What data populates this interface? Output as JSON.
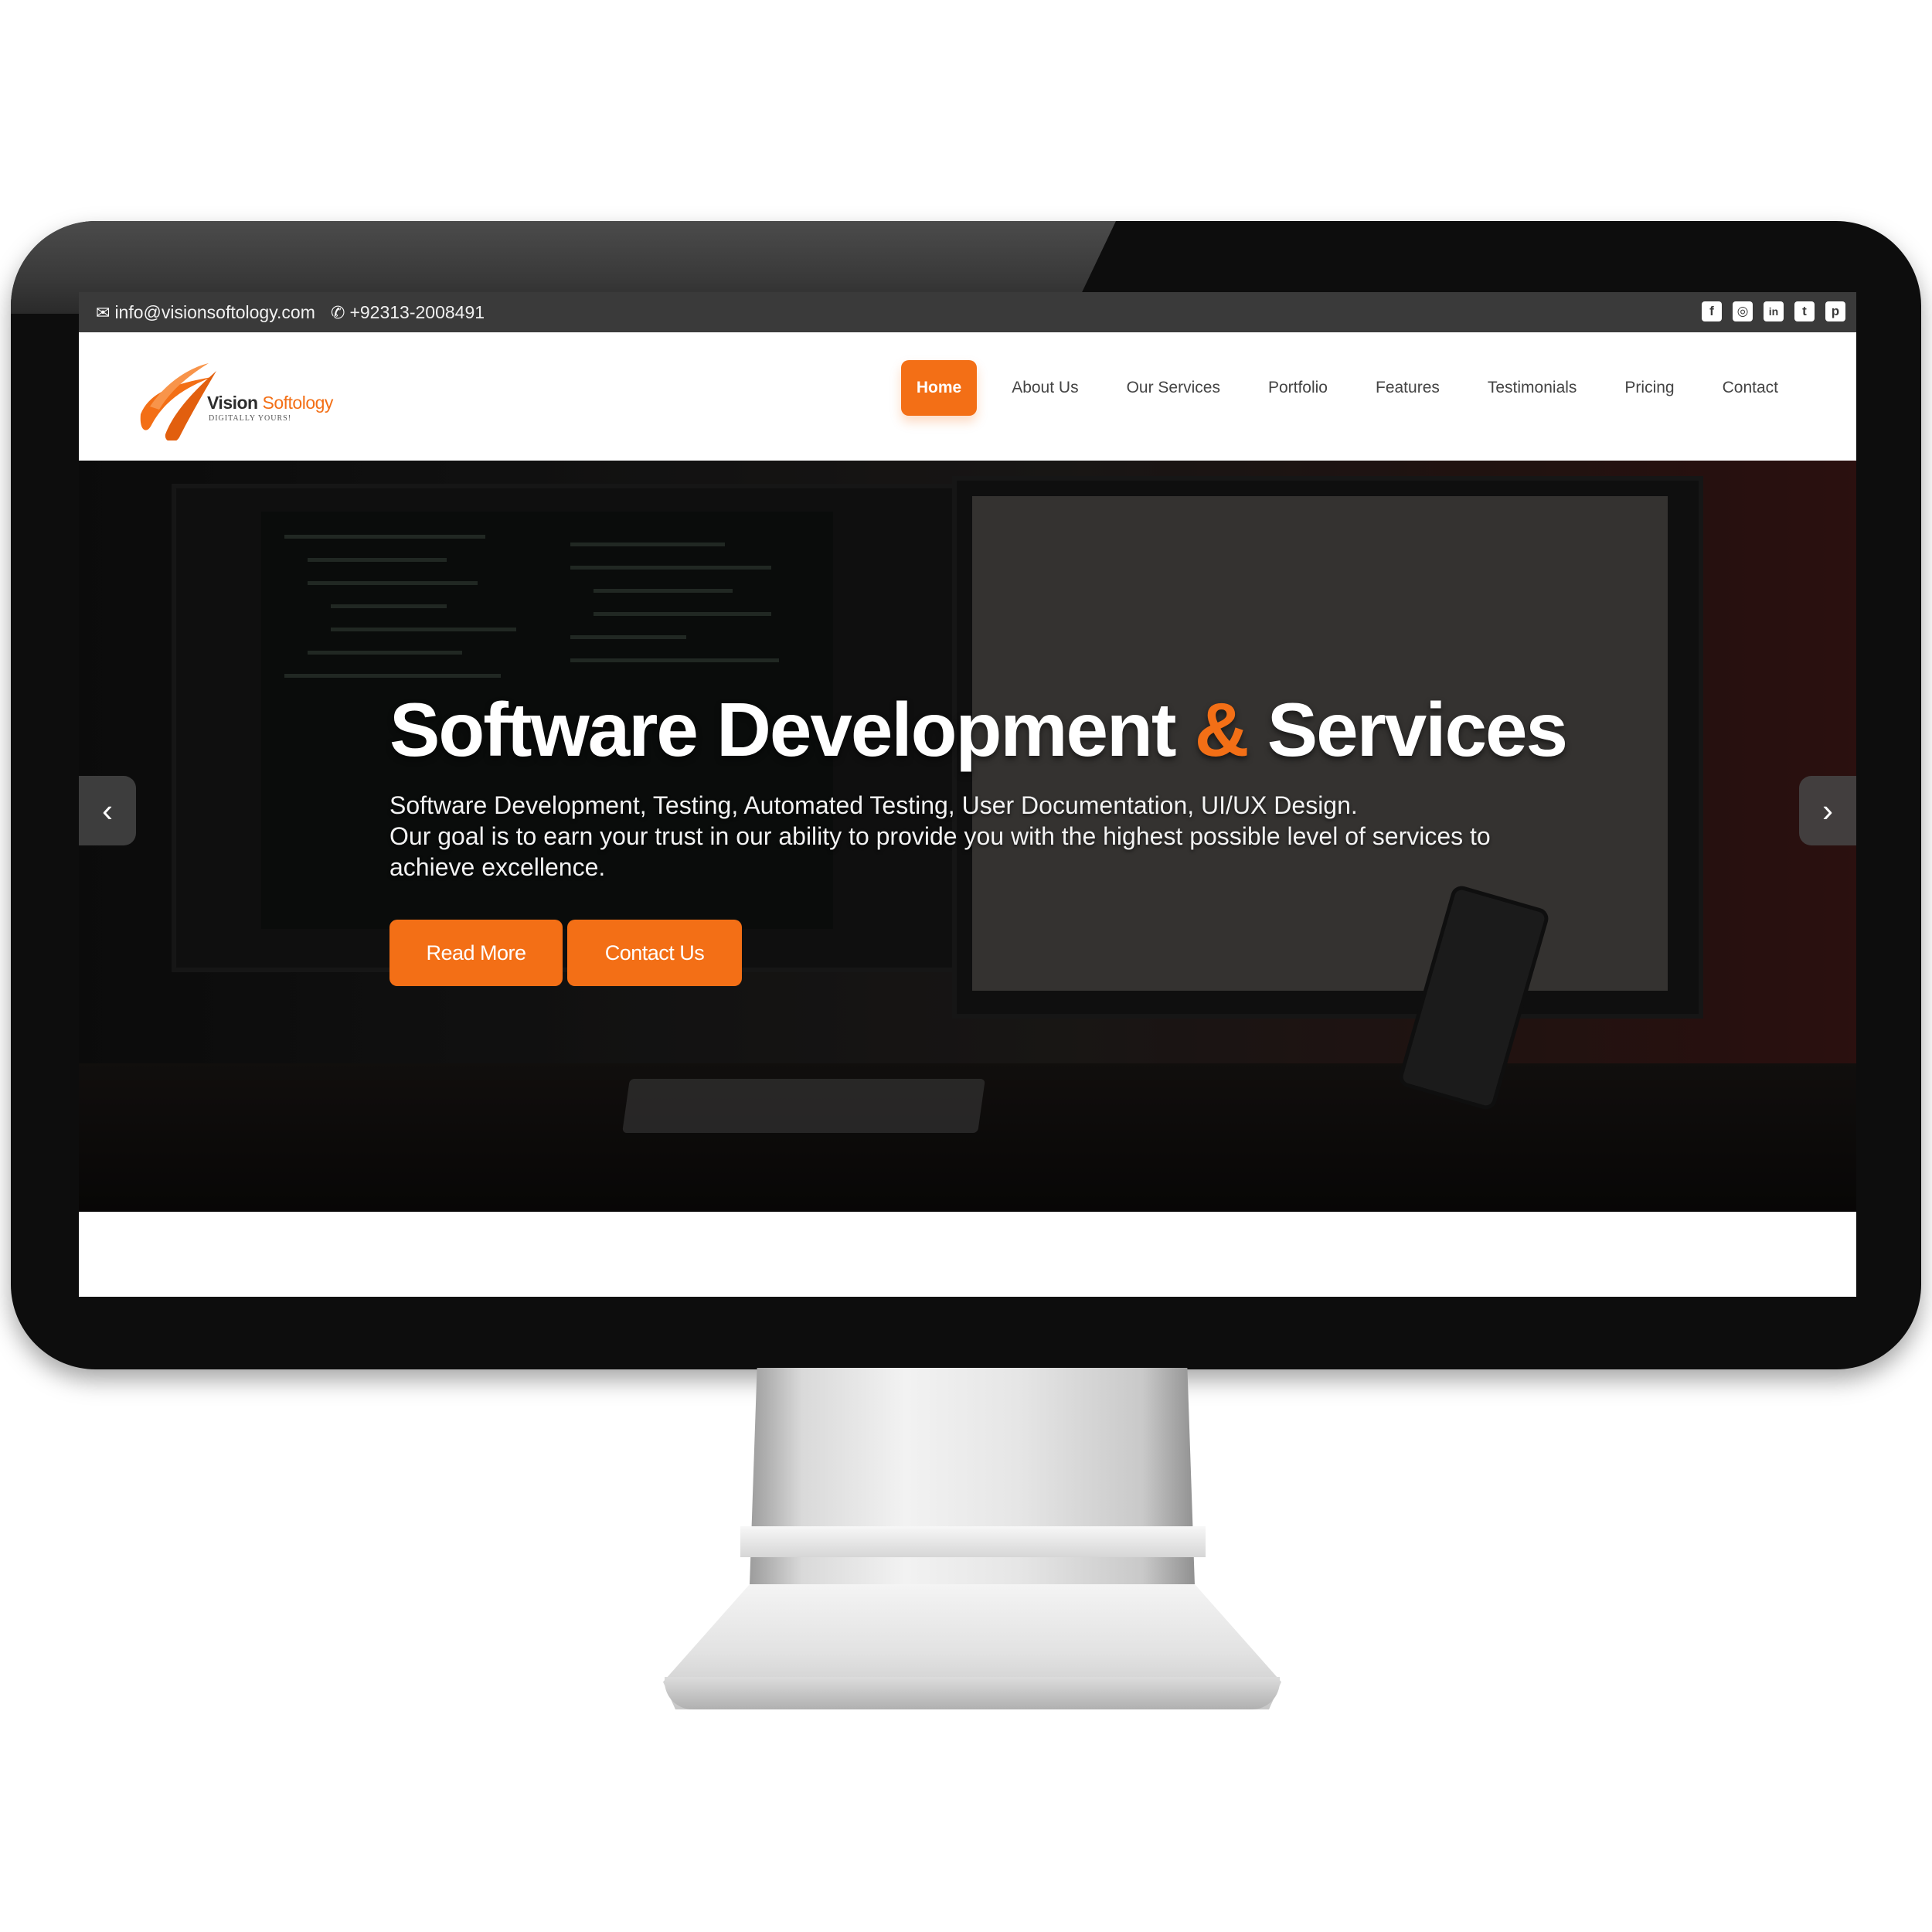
{
  "topbar": {
    "email": "info@visionsoftology.com",
    "phone": "+92313-2008491",
    "socials": [
      {
        "name": "facebook",
        "glyph": "f"
      },
      {
        "name": "instagram",
        "glyph": "◎"
      },
      {
        "name": "linkedin",
        "glyph": "in"
      },
      {
        "name": "twitter",
        "glyph": "t"
      },
      {
        "name": "pinterest",
        "glyph": "p"
      }
    ]
  },
  "brand": {
    "name_first": "Vision",
    "name_second": "Softology",
    "tagline": "DIGITALLY YOURS!",
    "accent_color": "#f36f16"
  },
  "nav": {
    "items": [
      "Home",
      "About Us",
      "Our Services",
      "Portfolio",
      "Features",
      "Testimonials",
      "Pricing",
      "Contact"
    ],
    "active": "Home"
  },
  "hero": {
    "title_part1": "Software Development",
    "title_amp": "&",
    "title_part2": "Services",
    "desc_line1": "Software Development, Testing, Automated Testing, User Documentation, UI/UX Design.",
    "desc_line2": "Our goal is to earn your trust in our ability to provide you with the highest possible level of services to achieve excellence.",
    "btn_read_more": "Read More",
    "btn_contact": "Contact Us",
    "prev_arrow": "‹",
    "next_arrow": "›"
  }
}
